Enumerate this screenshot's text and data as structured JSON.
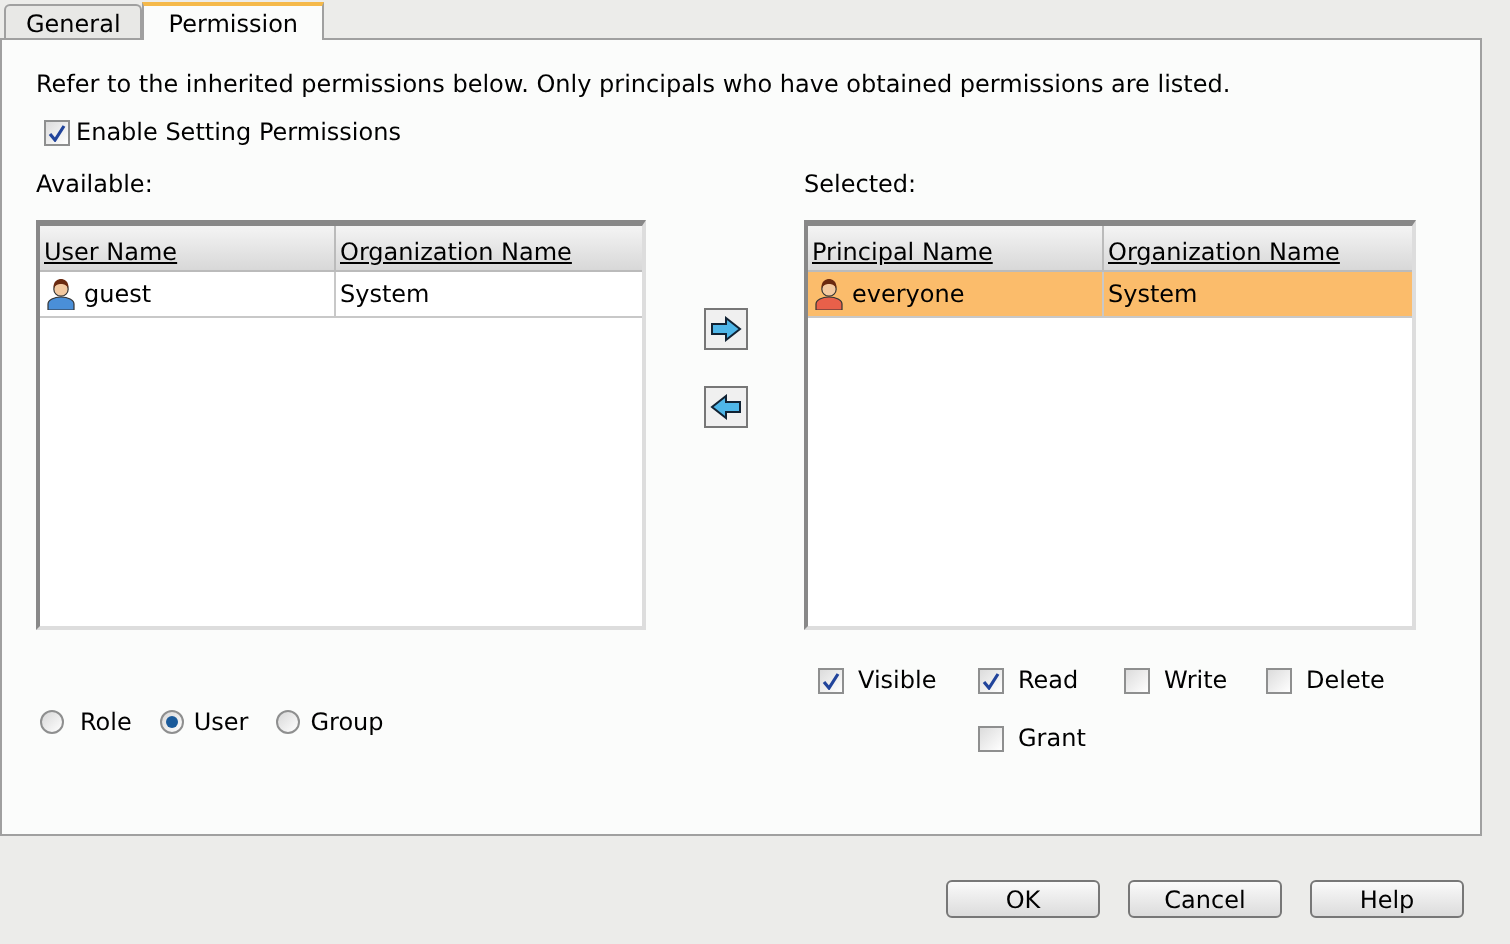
{
  "tabs": [
    {
      "label": "General",
      "selected": false
    },
    {
      "label": "Permission",
      "selected": true
    }
  ],
  "description": "Refer to the inherited permissions below. Only principals who have obtained permissions are listed.",
  "enable_setting": {
    "label": "Enable Setting Permissions",
    "checked": true
  },
  "available": {
    "label": "Available:",
    "columns": [
      "User Name",
      "Organization Name"
    ],
    "rows": [
      {
        "name": "guest",
        "organization": "System",
        "selected": false
      }
    ]
  },
  "selected_list": {
    "label": "Selected:",
    "columns": [
      "Principal Name",
      "Organization Name"
    ],
    "rows": [
      {
        "name": "everyone",
        "organization": "System",
        "selected": true
      }
    ]
  },
  "principal_types": [
    {
      "label": "Role",
      "selected": false
    },
    {
      "label": "User",
      "selected": true
    },
    {
      "label": "Group",
      "selected": false
    }
  ],
  "permissions": [
    {
      "label": "Visible",
      "checked": true
    },
    {
      "label": "Read",
      "checked": true
    },
    {
      "label": "Write",
      "checked": false
    },
    {
      "label": "Delete",
      "checked": false
    },
    {
      "label": "Grant",
      "checked": false
    }
  ],
  "buttons": [
    "OK",
    "Cancel",
    "Help"
  ]
}
